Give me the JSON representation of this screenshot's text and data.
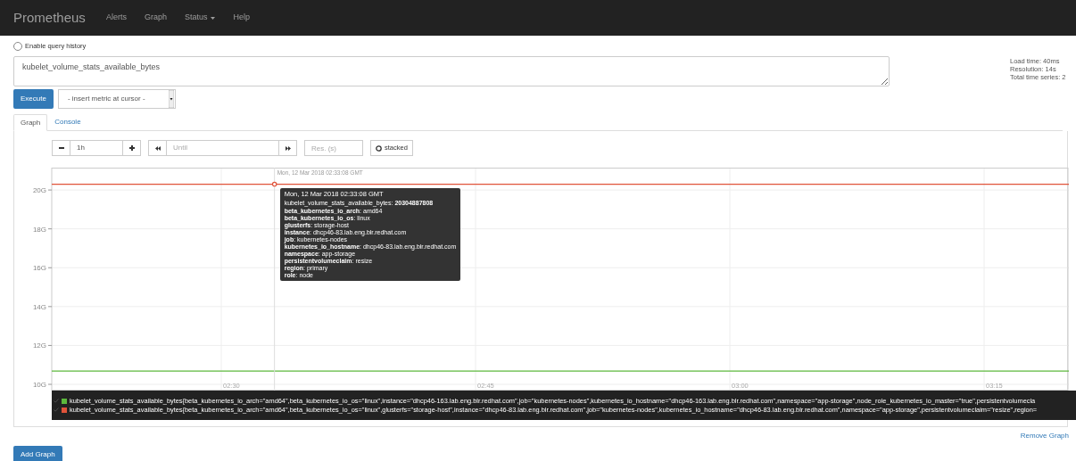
{
  "navbar": {
    "brand": "Prometheus",
    "links": [
      {
        "label": "Alerts",
        "dropdown": false
      },
      {
        "label": "Graph",
        "dropdown": false
      },
      {
        "label": "Status",
        "dropdown": true
      },
      {
        "label": "Help",
        "dropdown": false
      }
    ]
  },
  "query_history": {
    "label": "Enable query history",
    "checked": false
  },
  "query": {
    "value": "kubelet_volume_stats_available_bytes"
  },
  "stats": [
    "Load time: 40ms",
    "Resolution: 14s",
    "Total time series: 2"
  ],
  "execute_button": "Execute",
  "metric_select": "- insert metric at cursor -",
  "tabs": [
    {
      "label": "Graph",
      "selected": true
    },
    {
      "label": "Console",
      "selected": false
    }
  ],
  "controls": {
    "range": "1h",
    "until_placeholder": "Until",
    "resolution_placeholder": "Res. (s)",
    "stacked": {
      "label": "stacked",
      "checked": false
    }
  },
  "graph": {
    "chart_data": {
      "type": "line",
      "ylim": [
        9.68,
        21.15
      ],
      "categories": [
        null,
        null,
        "02:30",
        null,
        null,
        "02:45",
        null,
        null,
        "03:00",
        null,
        null,
        "03:15",
        null
      ],
      "grid": true,
      "yticks": [
        {
          "value": 10,
          "label": "10G"
        },
        {
          "value": 12,
          "label": "12G"
        },
        {
          "value": 14,
          "label": "14G"
        },
        {
          "value": 16,
          "label": "16G"
        },
        {
          "value": 18,
          "label": "18G"
        },
        {
          "value": 20,
          "label": "20G"
        }
      ],
      "series": [
        {
          "color": "#5cb83c",
          "values": [
            10.68,
            10.68,
            10.68,
            10.68,
            10.68,
            10.68,
            10.68,
            10.68,
            10.68,
            10.68,
            10.68,
            10.68,
            10.68
          ]
        },
        {
          "color": "#e0533a",
          "values": [
            20.3,
            20.3,
            20.3,
            20.3,
            20.3,
            20.3,
            20.3,
            20.3,
            20.3,
            20.3,
            20.3,
            20.3,
            20.3
          ]
        }
      ]
    },
    "hover": {
      "axis_label": "Mon, 12 Mar 2018 02:33:08 GMT",
      "title": "Mon, 12 Mar 2018 02:33:08 GMT",
      "metric": "kubelet_volume_stats_available_bytes: **20304887808**",
      "labels": [
        "**beta_kubernetes_io_arch**: amd64",
        "**beta_kubernetes_io_os**: linux",
        "**glusterfs**: storage-host",
        "**instance**: dhcp46-83.lab.eng.blr.redhat.com",
        "**job**: kubernetes-nodes",
        "**kubernetes_io_hostname**: dhcp46-83.lab.eng.blr.redhat.com",
        "**namespace**: app-storage",
        "**persistentvolumeclaim**: resize",
        "**region**: primary",
        "**role**: node"
      ]
    },
    "legend": [
      {
        "color": "#5cb83c",
        "text": "kubelet_volume_stats_available_bytes{beta_kubernetes_io_arch=\"amd64\",beta_kubernetes_io_os=\"linux\",instance=\"dhcp46-163.lab.eng.blr.redhat.com\",job=\"kubernetes-nodes\",kubernetes_io_hostname=\"dhcp46-163.lab.eng.blr.redhat.com\",namespace=\"app-storage\",node_role_kubernetes_io_master=\"true\",persistentvolumecla"
      },
      {
        "color": "#e0533a",
        "text": "kubelet_volume_stats_available_bytes{beta_kubernetes_io_arch=\"amd64\",beta_kubernetes_io_os=\"linux\",glusterfs=\"storage-host\",instance=\"dhcp46-83.lab.eng.blr.redhat.com\",job=\"kubernetes-nodes\",kubernetes_io_hostname=\"dhcp46-83.lab.eng.blr.redhat.com\",namespace=\"app-storage\",persistentvolumeclaim=\"resize\",region="
      }
    ]
  },
  "remove_graph": "Remove Graph",
  "add_graph": "Add Graph"
}
